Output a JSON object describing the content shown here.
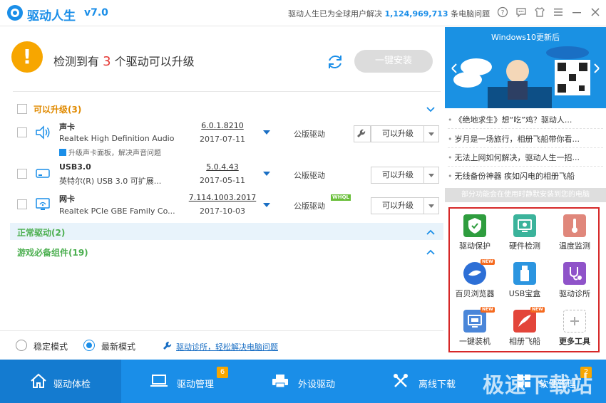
{
  "app": {
    "name": "驱动人生",
    "version": "v7.0",
    "stat_prefix": "驱动人生已为全球用户解决",
    "stat_number": "1,124,969,713",
    "stat_suffix": "条电脑问题"
  },
  "alert": {
    "icon": "exclamation-icon",
    "prefix": "检测到有",
    "count": "3",
    "suffix": "个驱动可以升级",
    "install_label": "一键安装"
  },
  "sections": {
    "upgradable": "可以升级(3)",
    "normal": "正常驱动(2)",
    "game": "游戏必备组件(19)"
  },
  "drivers": [
    {
      "name": "声卡",
      "desc": "Realtek High Definition Audio",
      "sub": "升级声卡面板，解决声音问题",
      "version": "6.0.1.8210",
      "date": "2017-07-11",
      "type": "公版驱动",
      "action": "可以升级",
      "icon": "speaker-icon"
    },
    {
      "name": "USB3.0",
      "desc": "英特尔(R) USB 3.0 可扩展...",
      "version": "5.0.4.43",
      "date": "2017-05-11",
      "type": "公版驱动",
      "action": "可以升级",
      "icon": "usb-drive-icon"
    },
    {
      "name": "网卡",
      "desc": "Realtek PCIe GBE Family Co...",
      "version": "7.114.1003.2017",
      "date": "2017-10-03",
      "type": "公版驱动",
      "badge": "WHQL",
      "action": "可以升级",
      "icon": "network-icon"
    }
  ],
  "modes": {
    "stable": "稳定模式",
    "latest": "最新模式",
    "selected": "latest",
    "diag_link": "驱动诊所，轻松解决电脑问题"
  },
  "banner": {
    "title": "Windows10更新后"
  },
  "news": [
    "《绝地求生》想“吃”鸡？驱动人...",
    "岁月是一场旅行，相册飞船带你看...",
    "无法上网如何解决，驱动人生一招...",
    "无线备份神器 疾如闪电的相册飞船"
  ],
  "notice": "部分功能会在使用时静默安装到您的电脑",
  "tools": [
    {
      "label": "驱动保护",
      "icon": "shield-check-icon",
      "color": "#2e9d3e",
      "new": false
    },
    {
      "label": "硬件检测",
      "icon": "monitor-icon",
      "color": "#3bb39b",
      "new": false
    },
    {
      "label": "温度监测",
      "icon": "thermometer-icon",
      "color": "#e0877b",
      "new": false
    },
    {
      "label": "百贝浏览器",
      "icon": "browser-icon",
      "color": "#2d6fd6",
      "new": true
    },
    {
      "label": "USB宝盒",
      "icon": "usb-icon",
      "color": "#2b95e0",
      "new": false
    },
    {
      "label": "驱动诊所",
      "icon": "clinic-icon",
      "color": "#8f53c9",
      "new": false
    },
    {
      "label": "一键装机",
      "icon": "install-pc-icon",
      "color": "#4a86d9",
      "new": true
    },
    {
      "label": "相册飞船",
      "icon": "airship-icon",
      "color": "#e3453a",
      "new": true
    },
    {
      "label": "更多工具",
      "icon": "plus-icon",
      "color": "#ffffff",
      "new": false
    }
  ],
  "nav": [
    {
      "label": "驱动体检",
      "icon": "home-icon",
      "active": true
    },
    {
      "label": "驱动管理",
      "icon": "laptop-icon",
      "badge": "6"
    },
    {
      "label": "外设驱动",
      "icon": "printer-icon"
    },
    {
      "label": "离线下载",
      "icon": "tools-icon"
    },
    {
      "label": "软件管理",
      "icon": "apps-icon",
      "badge": "2"
    }
  ],
  "watermark": "极速下载站",
  "colors": {
    "brand": "#1a8ee8",
    "warning": "#f7a600",
    "section_upgradable": "#e08a00",
    "section_green": "#4caf50",
    "highlight_box": "#d62828"
  }
}
